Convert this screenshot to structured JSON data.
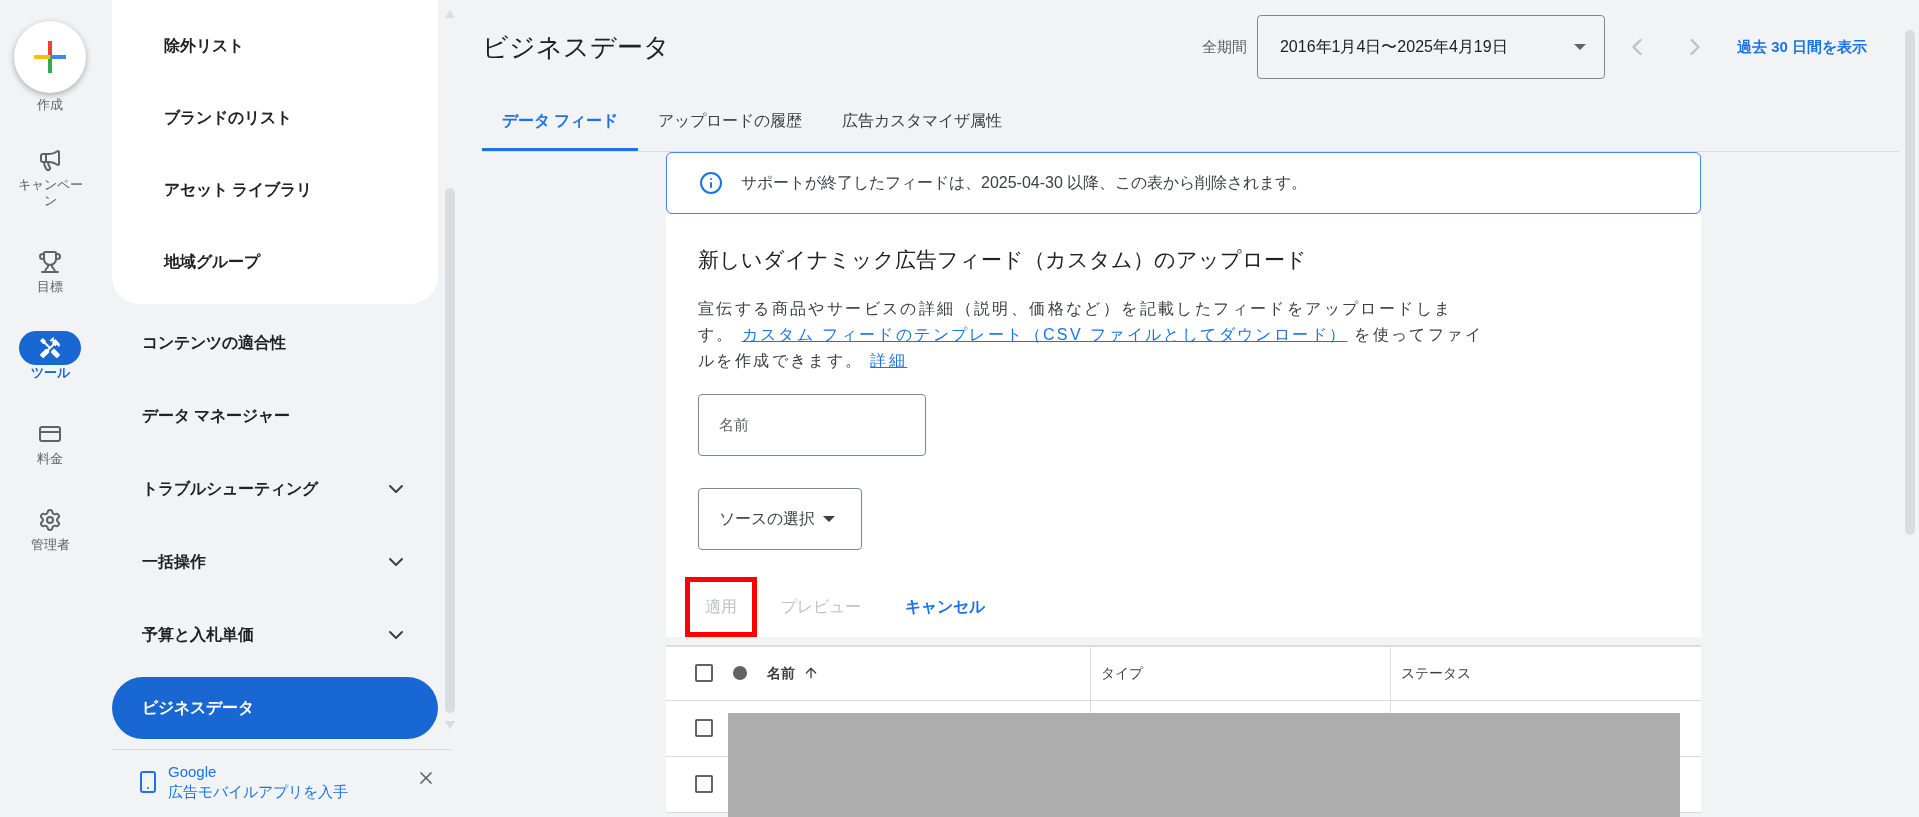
{
  "rail": {
    "create_label": "作成",
    "items": [
      {
        "kind": "campaign",
        "label": "キャンペーン",
        "selected": false
      },
      {
        "kind": "goals",
        "label": "目標",
        "selected": false
      },
      {
        "kind": "tools",
        "label": "ツール",
        "selected": true
      },
      {
        "kind": "billing",
        "label": "料金",
        "selected": false
      },
      {
        "kind": "admin",
        "label": "管理者",
        "selected": false
      }
    ]
  },
  "sidebar": {
    "sub_items": [
      "除外リスト",
      "ブランドのリスト",
      "アセット ライブラリ",
      "地域グループ"
    ],
    "items": [
      {
        "label": "コンテンツの適合性",
        "expandable": false,
        "selected": false
      },
      {
        "label": "データ マネージャー",
        "expandable": false,
        "selected": false
      },
      {
        "label": "トラブルシューティング",
        "expandable": true,
        "selected": false
      },
      {
        "label": "一括操作",
        "expandable": true,
        "selected": false
      },
      {
        "label": "予算と入札単価",
        "expandable": true,
        "selected": false
      },
      {
        "label": "ビジネスデータ",
        "expandable": false,
        "selected": true
      }
    ],
    "promo": {
      "title": "Google",
      "subtitle": "広告モバイルアプリを入手"
    }
  },
  "header": {
    "title": "ビジネスデータ",
    "period_label": "全期間",
    "date_range": "2016年1月4日〜2025年4月19日",
    "last_30_link": "過去 30 日間を表示"
  },
  "tabs": [
    {
      "label": "データ フィード",
      "selected": true
    },
    {
      "label": "アップロードの履歴",
      "selected": false
    },
    {
      "label": "広告カスタマイザ属性",
      "selected": false
    }
  ],
  "banner": "サポートが終了したフィードは、2025-04-30 以降、この表から削除されます。",
  "upload": {
    "title": "新しいダイナミック広告フィード（カスタム）のアップロード",
    "description": [
      {
        "kind": "text",
        "text": "宣伝する商品やサービスの詳細（説明、価格など）を記載したフィードをアップロードします。 "
      },
      {
        "kind": "link",
        "text": "カスタム フィードのテンプレート（CSV ファイルとしてダウンロード）"
      },
      {
        "kind": "text",
        "text": " を使ってファイルを作成できます。 "
      },
      {
        "kind": "link",
        "text": "詳細"
      }
    ],
    "name_placeholder": "名前",
    "source_label": "ソースの選択",
    "buttons": [
      {
        "label": "適用",
        "disabled": true,
        "highlighted": true
      },
      {
        "label": "プレビュー",
        "disabled": true,
        "highlighted": false
      },
      {
        "label": "キャンセル",
        "disabled": false,
        "highlighted": false
      }
    ]
  },
  "table": {
    "columns": [
      {
        "label": "名前",
        "sorted": true
      },
      {
        "label": "タイプ",
        "sorted": false
      },
      {
        "label": "ステータス",
        "sorted": false
      }
    ],
    "header_checked": false,
    "rows": [
      {
        "checked": false
      },
      {
        "checked": false
      }
    ],
    "redacted": true
  }
}
